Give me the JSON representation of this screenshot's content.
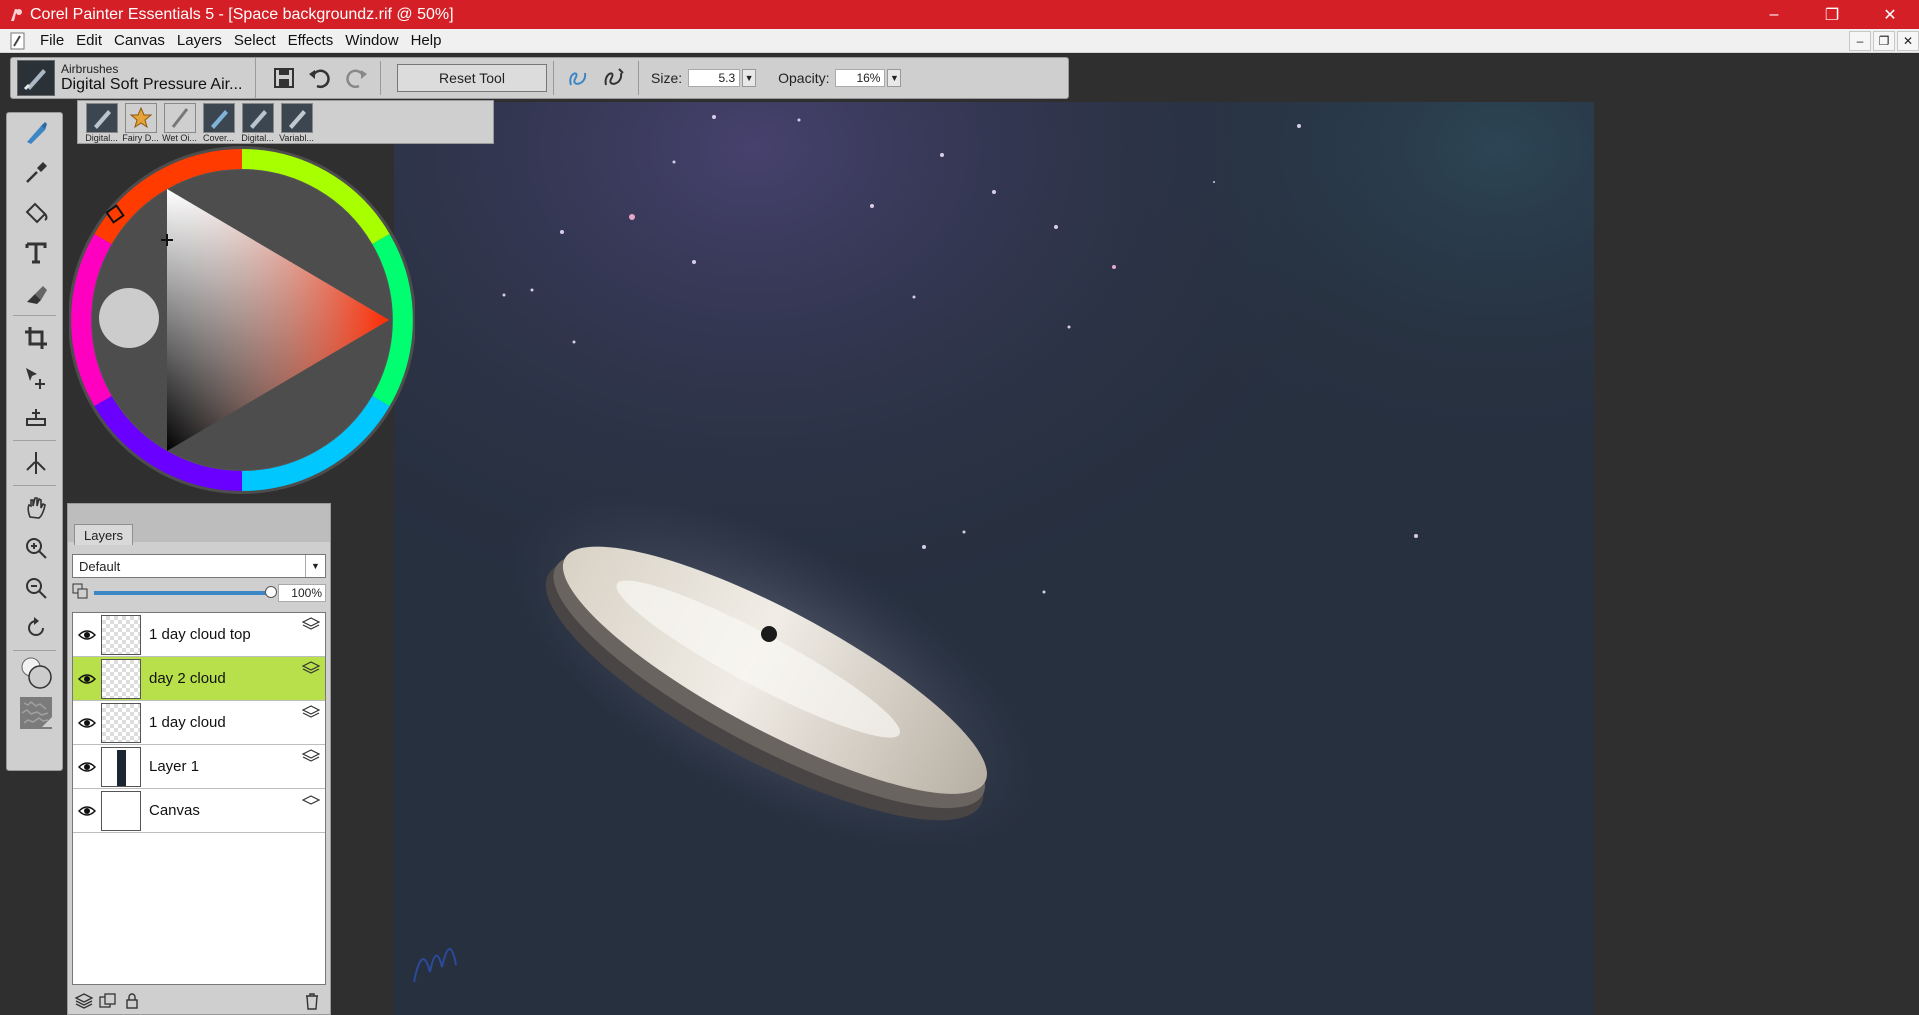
{
  "window": {
    "title": "Corel Painter Essentials 5 - [Space backgroundz.rif @ 50%]",
    "controls": {
      "minimize": "–",
      "restore": "❐",
      "close": "✕"
    }
  },
  "menu": {
    "items": [
      "File",
      "Edit",
      "Canvas",
      "Layers",
      "Select",
      "Effects",
      "Window",
      "Help"
    ],
    "mdi": {
      "minimize": "–",
      "restore": "❐",
      "close": "✕"
    }
  },
  "property_bar": {
    "brush_category": "Airbrushes",
    "brush_variant": "Digital Soft Pressure Air...",
    "reset_label": "Reset Tool",
    "size_label": "Size:",
    "size_value": "5.3",
    "opacity_label": "Opacity:",
    "opacity_value": "16%"
  },
  "brush_strip": {
    "items": [
      "Digital...",
      "Fairy D...",
      "Wet Oi...",
      "Cover...",
      "Digital...",
      "Variabl..."
    ]
  },
  "layers_panel": {
    "tab_label": "Layers",
    "blend_mode": "Default",
    "opacity": "100%",
    "layers": [
      {
        "name": "1 day cloud top",
        "selected": false
      },
      {
        "name": "day 2  cloud",
        "selected": true
      },
      {
        "name": "1 day cloud",
        "selected": false
      },
      {
        "name": "Layer 1",
        "selected": false
      },
      {
        "name": "Canvas",
        "selected": false
      }
    ]
  },
  "colors": {
    "title_bar": "#d51f27",
    "selection": "#b7e04a",
    "accent": "#3d86c6",
    "main_color": "#cccccc"
  }
}
